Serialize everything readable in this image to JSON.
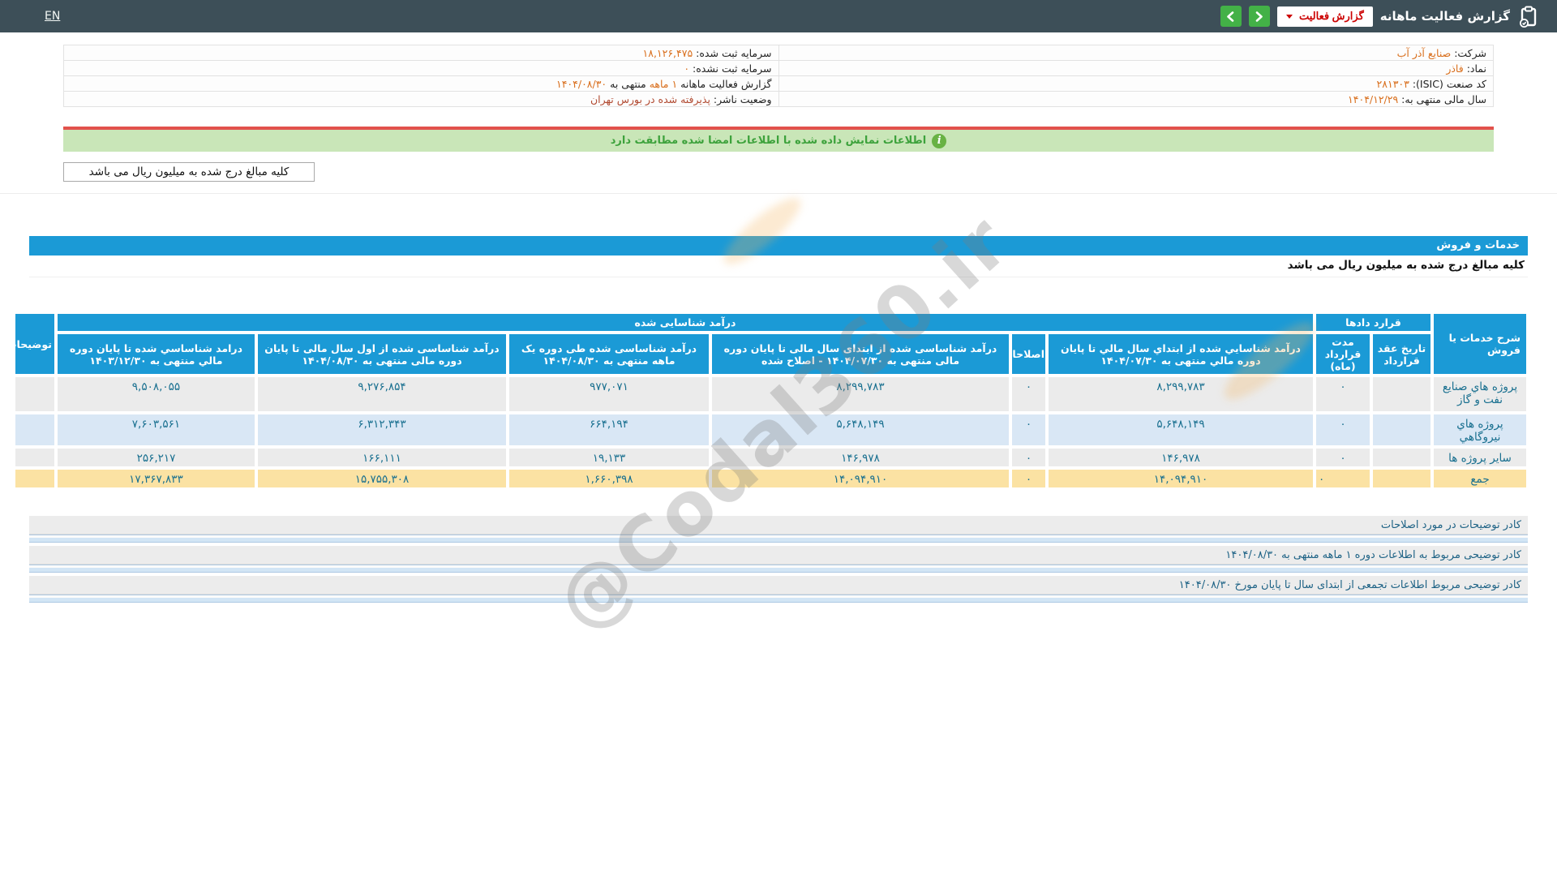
{
  "topbar": {
    "title": "گزارش فعالیت ماهانه",
    "dropdown_label": "گزارش فعالیت",
    "lang_link": "EN"
  },
  "info": {
    "right_rows": [
      {
        "label": "شرکت:",
        "value": "صنایع آذر آب"
      },
      {
        "label": "نماد:",
        "value": "فاذر"
      },
      {
        "label": "کد صنعت (ISIC):",
        "value": "۲۸۱۳۰۳"
      },
      {
        "label": "سال مالی منتهی به:",
        "value": "۱۴۰۴/۱۲/۲۹"
      }
    ],
    "left_rows": [
      {
        "label": "سرمایه ثبت شده:",
        "value": "۱۸,۱۲۶,۴۷۵"
      },
      {
        "label": "سرمایه ثبت نشده:",
        "value": "۰"
      },
      {
        "label": "گزارش فعالیت ماهانه",
        "highlight": "۱ ماهه",
        "label2": "منتهی به",
        "value": "۱۴۰۴/۰۸/۳۰"
      },
      {
        "label": "وضعیت ناشر:",
        "value": "پذیرفته شده در بورس تهران"
      }
    ]
  },
  "notice": {
    "signed_info": "اطلاعات نمایش داده شده با اطلاعات امضا شده مطابقت دارد",
    "info_icon_glyph": "i",
    "amounts_note": "کلیه مبالغ درج شده به میلیون ریال می باشد"
  },
  "section": {
    "title": "خدمات و فروش",
    "amounts_note": "کلیه مبالغ درج شده به میلیون ریال می باشد"
  },
  "table": {
    "group_headers": {
      "description": "شرح خدمات یا فروش",
      "contracts": "قرارد دادها",
      "revenue": "درآمد شناسایی شده",
      "comments": "توضیحات"
    },
    "sub_headers": [
      "تاریخ عقد قرارداد",
      "مدت قرارداد (ماه)",
      "درآمد شناسايي شده از ابتداي سال مالي تا پایان دوره مالي منتهی به ۱۴۰۴/۰۷/۳۰",
      "اصلاحات",
      "درآمد شناساسی شده از ابتدای سال مالی تا پایان دوره مالی منتهی به ۱۴۰۴/۰۷/۳۰ - اصلاح شده",
      "درآمد شناساسی شده طی دوره یک ماهه منتهی به ۱۴۰۴/۰۸/۳۰",
      "درآمد شناساسی شده از اول سال مالی تا پایان دوره مالی منتهی به ۱۴۰۴/۰۸/۳۰",
      "درامد شناساسي شده تا پایان دوره مالي منتهی به ۱۴۰۳/۱۲/۳۰"
    ],
    "rows": [
      {
        "label": "پروژه هاي صنایع نفت و گاز",
        "contract_date": "",
        "duration": "۰",
        "rev_to_0730": "۸,۲۹۹,۷۸۳",
        "adjustments": "۰",
        "rev_to_0730_adj": "۸,۲۹۹,۷۸۳",
        "rev_month": "۹۷۷,۰۷۱",
        "rev_ytd": "۹,۲۷۶,۸۵۴",
        "rev_prev_year": "۹,۵۰۸,۰۵۵",
        "comments": ""
      },
      {
        "label": "پروژه هاي نيروگاهي",
        "contract_date": "",
        "duration": "۰",
        "rev_to_0730": "۵,۶۴۸,۱۴۹",
        "adjustments": "۰",
        "rev_to_0730_adj": "۵,۶۴۸,۱۴۹",
        "rev_month": "۶۶۴,۱۹۴",
        "rev_ytd": "۶,۳۱۲,۳۴۳",
        "rev_prev_year": "۷,۶۰۳,۵۶۱",
        "comments": ""
      },
      {
        "label": "سایر پروژه ها",
        "contract_date": "",
        "duration": "۰",
        "rev_to_0730": "۱۴۶,۹۷۸",
        "adjustments": "۰",
        "rev_to_0730_adj": "۱۴۶,۹۷۸",
        "rev_month": "۱۹,۱۳۳",
        "rev_ytd": "۱۶۶,۱۱۱",
        "rev_prev_year": "۲۵۶,۲۱۷",
        "comments": ""
      },
      {
        "label": "جمع",
        "contract_date": "",
        "duration": "۰",
        "rev_to_0730": "۱۴,۰۹۴,۹۱۰",
        "adjustments": "۰",
        "rev_to_0730_adj": "۱۴,۰۹۴,۹۱۰",
        "rev_month": "۱,۶۶۰,۳۹۸",
        "rev_ytd": "۱۵,۷۵۵,۳۰۸",
        "rev_prev_year": "۱۷,۳۶۷,۸۳۳",
        "comments": ""
      }
    ]
  },
  "explanations": [
    {
      "label": "کادر توضیحات در مورد اصلاحات"
    },
    {
      "label": "کادر توضیحی مربوط به اطلاعات دوره ۱ ماهه منتهی به ۱۴۰۴/۰۸/۳۰"
    },
    {
      "label": "کادر توضیحی مربوط اطلاعات تجمعی از ابتدای سال تا پایان مورخ ۱۴۰۴/۰۸/۳۰"
    }
  ],
  "watermark": {
    "text": "@Codal360.ir"
  },
  "colors": {
    "topbar_bg": "#3d4f58",
    "accent_blue": "#1b9ad6",
    "accent_green": "#43b147",
    "danger_red": "#cc0000",
    "redline": "#e2514c",
    "green_notice_bg": "#c9e6b8",
    "total_row": "#fbe2a3",
    "alt_row_blue": "#d9e7f5",
    "value_orange": "#d96f1d",
    "number_text": "#186f8f"
  }
}
